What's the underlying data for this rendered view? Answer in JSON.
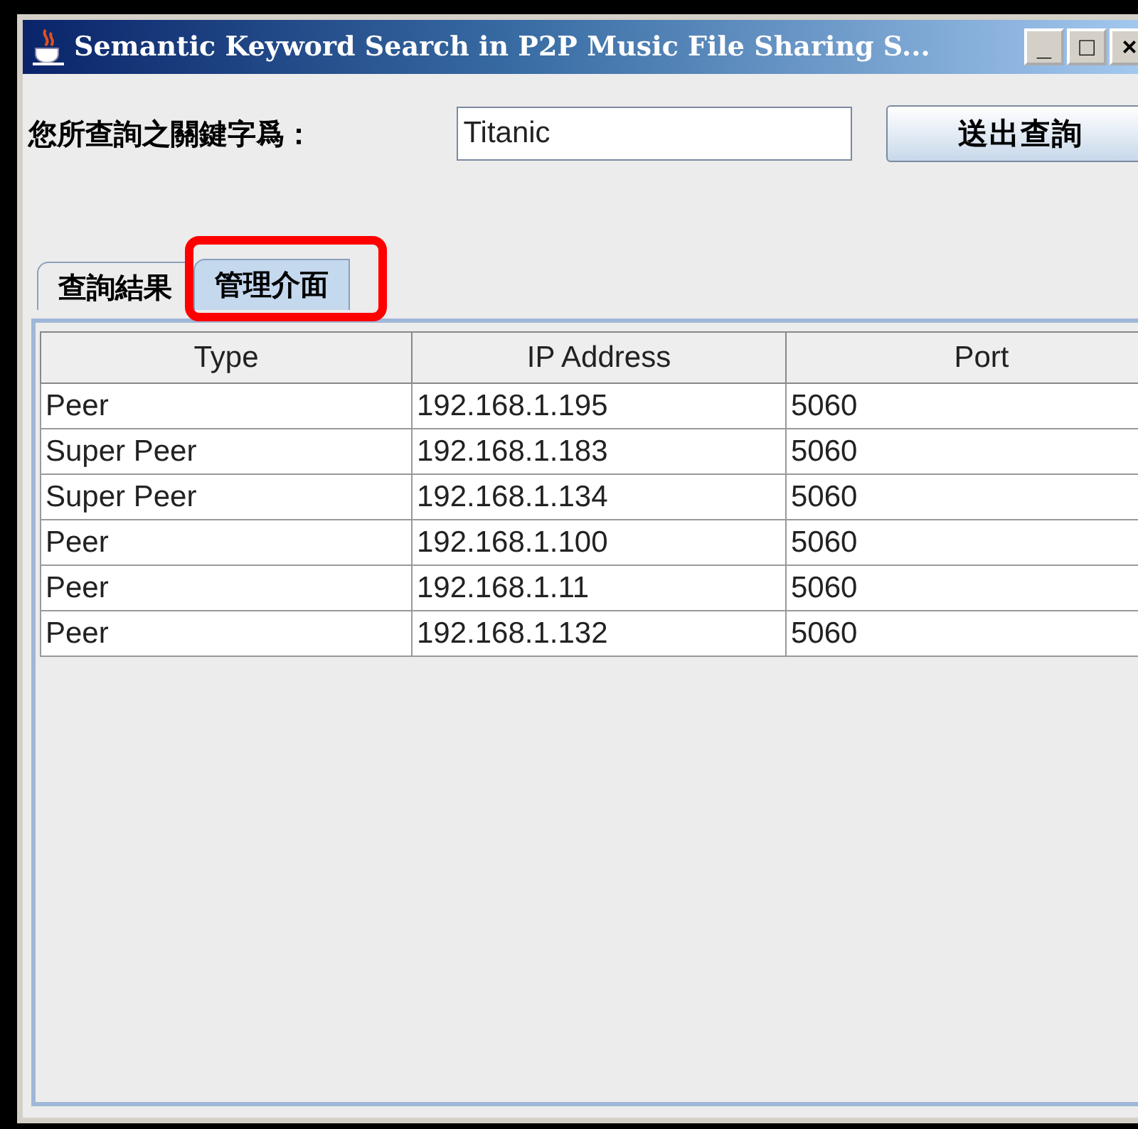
{
  "window": {
    "title": "Semantic Keyword Search in P2P Music File Sharing S...",
    "controls": [
      "_",
      "□",
      "×"
    ]
  },
  "query": {
    "label": "您所查詢之關鍵字爲：",
    "value": "Titanic",
    "button": "送出查詢"
  },
  "tabs": [
    {
      "label": "查詢結果",
      "selected": false,
      "highlighted": false
    },
    {
      "label": "管理介面",
      "selected": true,
      "highlighted": true
    }
  ],
  "table": {
    "columns": [
      "Type",
      "IP Address",
      "Port"
    ],
    "rows": [
      [
        "Peer",
        "192.168.1.195",
        "5060"
      ],
      [
        "Super Peer",
        "192.168.1.183",
        "5060"
      ],
      [
        "Super Peer",
        "192.168.1.134",
        "5060"
      ],
      [
        "Peer",
        "192.168.1.100",
        "5060"
      ],
      [
        "Peer",
        "192.168.1.11",
        "5060"
      ],
      [
        "Peer",
        "192.168.1.132",
        "5060"
      ]
    ]
  }
}
